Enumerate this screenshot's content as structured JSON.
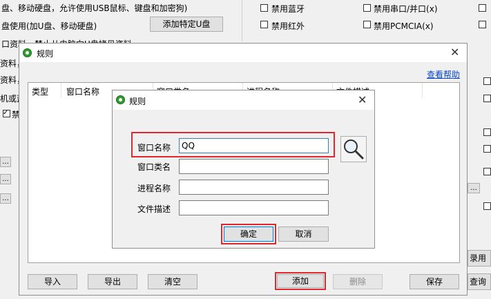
{
  "background": {
    "top_line1": "盘、移动硬盘，允许使用USB鼠标、键盘和加密狗)",
    "top_line2": "盘使用(加U盘、移动硬盘)",
    "add_specific_udisk": "添加特定U盘",
    "top_line3": "口资料，禁止从电脑向U盘拷贝资料",
    "left_frag1": "资料，",
    "left_frag2": "资料，",
    "left_frag3": "机或蓝",
    "left_frag4": "禁",
    "stub_label": "...",
    "checkboxes": {
      "bluetooth": "禁用蓝牙",
      "serial": "禁用串口/并口(x)",
      "infrared": "禁用红外",
      "pcmcia": "禁用PCMCIA(x)"
    },
    "right_partial1": "录用户",
    "right_partial2": "查询日"
  },
  "rules_window": {
    "title": "规则",
    "help_link": "查看帮助",
    "columns": [
      "类型",
      "窗口名称",
      "窗口类名",
      "进程名称",
      "文件描述"
    ],
    "buttons": {
      "import": "导入",
      "export": "导出",
      "clear": "清空",
      "add": "添加",
      "delete": "删除",
      "save": "保存"
    }
  },
  "rule_dialog": {
    "title": "规则",
    "window_name_label": "窗口名称",
    "window_name_value": "QQ",
    "window_class_label": "窗口类名",
    "window_class_value": "",
    "process_name_label": "进程名称",
    "process_name_value": "",
    "file_desc_label": "文件描述",
    "file_desc_value": "",
    "ok_label": "确定",
    "cancel_label": "取消"
  },
  "colors": {
    "highlight_red": "#e0262f",
    "link_blue": "#0a46c8"
  }
}
